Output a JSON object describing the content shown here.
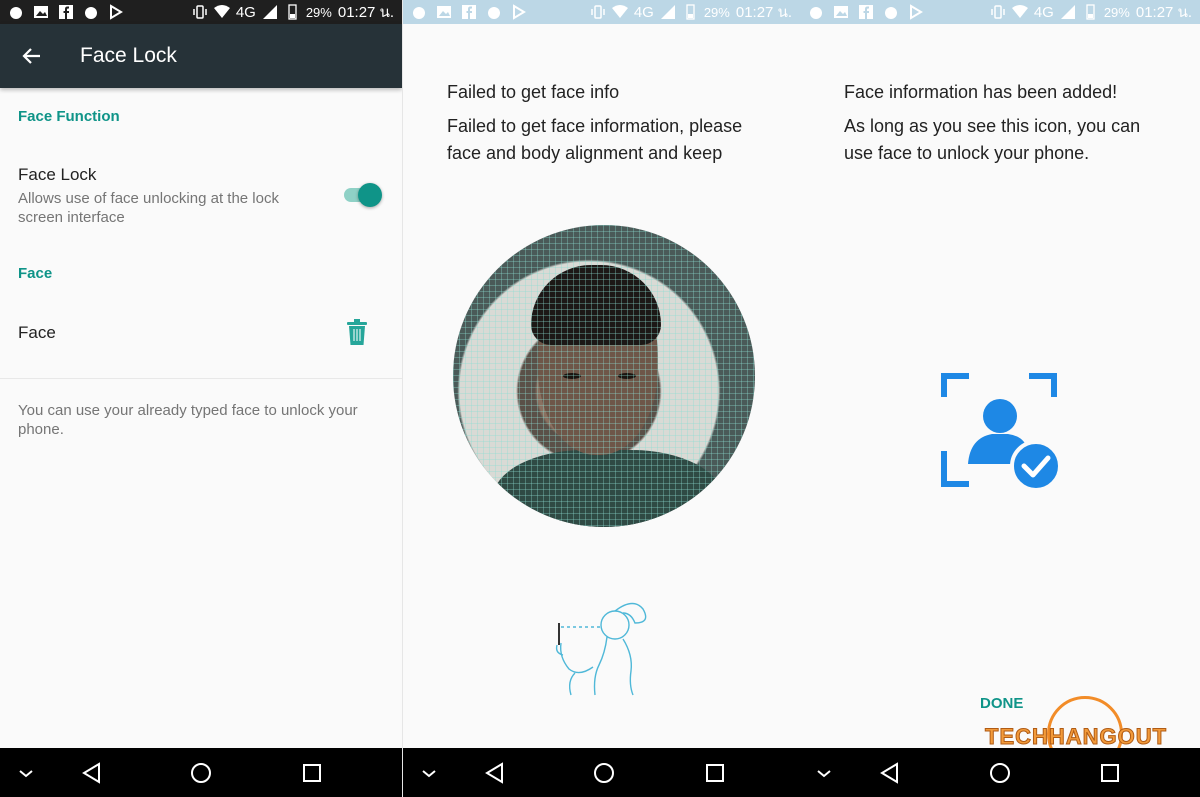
{
  "status_bar": {
    "network": "4G",
    "battery": "29%",
    "time": "01:27 น."
  },
  "panel1": {
    "title": "Face Lock",
    "section_face_function": "Face Function",
    "face_lock_title": "Face Lock",
    "face_lock_subtitle": "Allows use of face unlocking at the lock screen interface",
    "face_lock_enabled": true,
    "section_face": "Face",
    "face_item": "Face",
    "footer_note": "You can use your already typed face to unlock your phone."
  },
  "panel2": {
    "error_title": "Failed to get face info",
    "error_body": "Failed to get face information, please face and body alignment and keep"
  },
  "panel3": {
    "success_title": "Face information has been added!",
    "success_body": "As long as you see this icon, you can use face to unlock your phone.",
    "done_label": "DONE",
    "watermark": "TECHHANGOUT"
  },
  "colors": {
    "accent_teal": "#0f9488",
    "appbar": "#263238",
    "icon_blue": "#1e88e5"
  },
  "icons": [
    "back-arrow-icon",
    "trash-icon",
    "face-check-icon",
    "toggle-switch",
    "nav-back-icon",
    "nav-home-icon",
    "nav-recents-icon",
    "nav-collapse-icon"
  ]
}
